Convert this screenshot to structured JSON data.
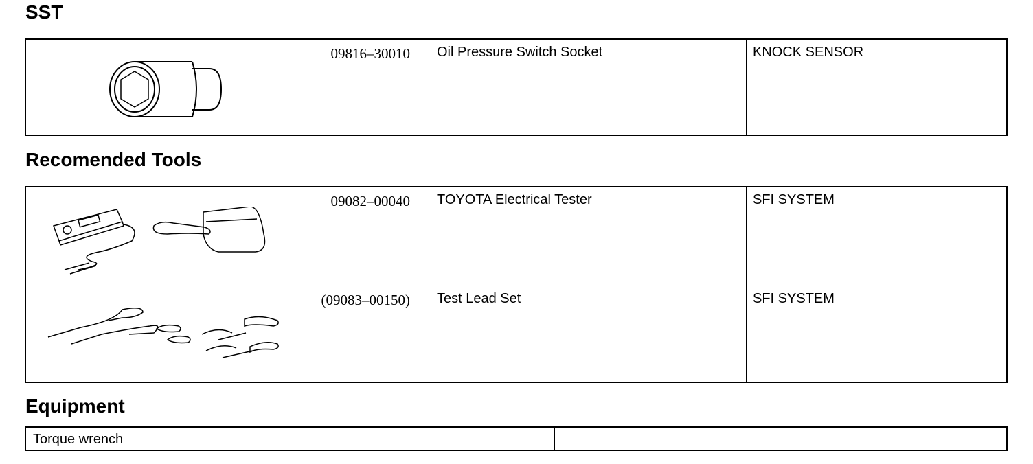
{
  "sst": {
    "heading": "SST",
    "rows": [
      {
        "part_no": "09816–30010",
        "name": "Oil Pressure Switch Socket",
        "section": "KNOCK SENSOR",
        "icon": "socket-icon"
      }
    ]
  },
  "recommended": {
    "heading": "Recomended Tools",
    "rows": [
      {
        "part_no": "09082–00040",
        "name": "TOYOTA Electrical Tester",
        "section": "SFI SYSTEM",
        "icon": "electrical-tester-icon"
      },
      {
        "part_no": "(09083–00150)",
        "name": "Test Lead Set",
        "section": "SFI SYSTEM",
        "icon": "test-lead-set-icon"
      }
    ]
  },
  "equipment": {
    "heading": "Equipment",
    "rows": [
      {
        "name": "Torque wrench",
        "note": ""
      }
    ]
  }
}
